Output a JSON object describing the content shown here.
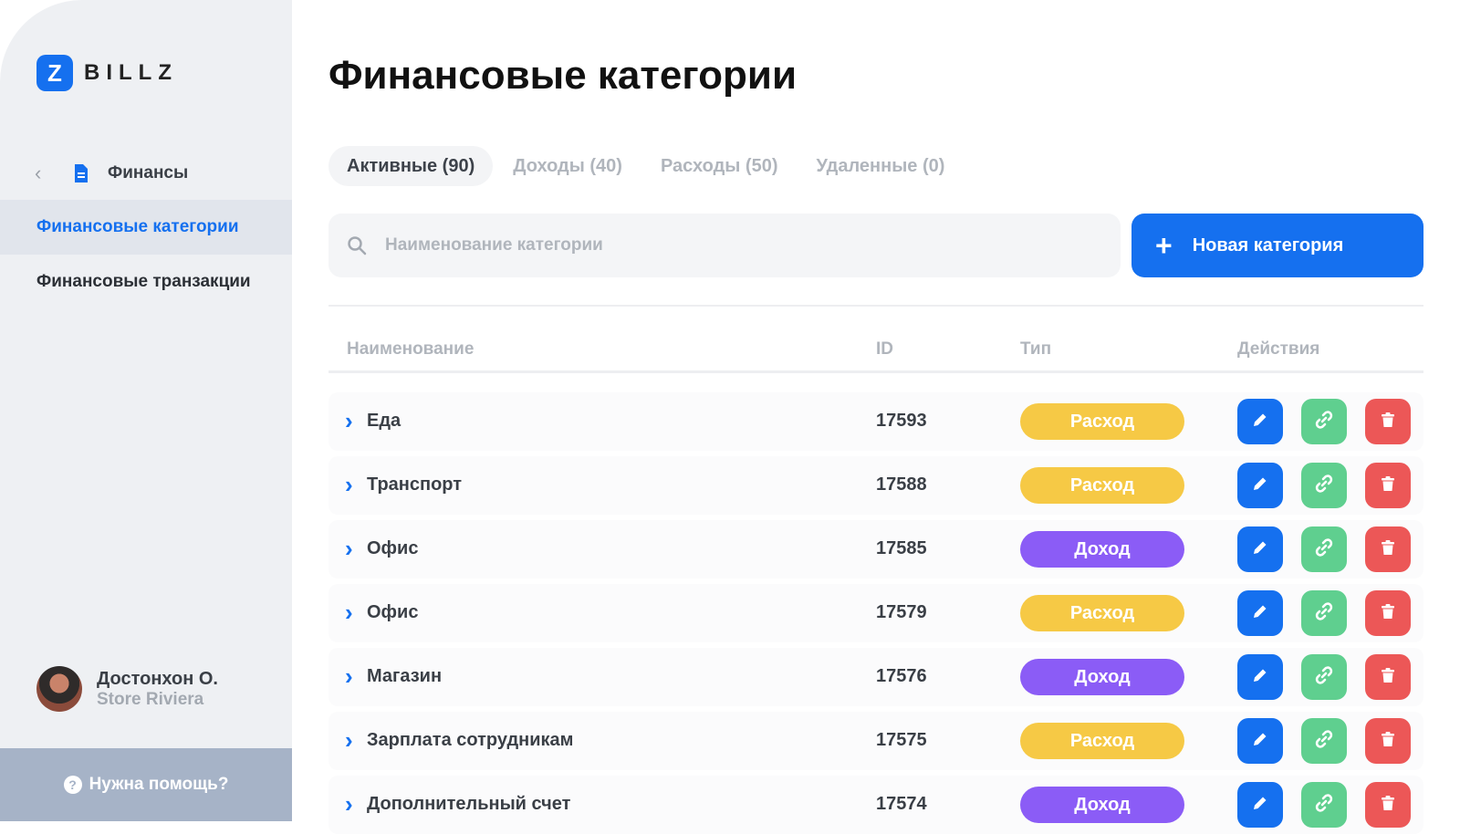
{
  "brand": {
    "badge": "Z",
    "name": "BILLZ"
  },
  "sidebar": {
    "back_label": "Финансы",
    "items": [
      {
        "label": "Финансовые категории",
        "active": true
      },
      {
        "label": "Финансовые транзакции",
        "active": false
      }
    ],
    "user": {
      "name": "Достонхон О.",
      "store": "Store Riviera"
    },
    "help_label": "Нужна помощь?"
  },
  "page": {
    "title": "Финансовые категории",
    "tabs": [
      {
        "label": "Активные (90)",
        "active": true
      },
      {
        "label": "Доходы (40)",
        "active": false
      },
      {
        "label": "Расходы (50)",
        "active": false
      },
      {
        "label": "Удаленные (0)",
        "active": false
      }
    ],
    "search": {
      "placeholder": "Наименование категории",
      "value": ""
    },
    "new_button": "Новая категория"
  },
  "table": {
    "headers": {
      "name": "Наименование",
      "id": "ID",
      "type": "Тип",
      "actions": "Действия"
    },
    "rows": [
      {
        "name": "Еда",
        "id": "17593",
        "type": "Расход"
      },
      {
        "name": "Транспорт",
        "id": "17588",
        "type": "Расход"
      },
      {
        "name": "Офис",
        "id": "17585",
        "type": "Доход"
      },
      {
        "name": "Офис",
        "id": "17579",
        "type": "Расход"
      },
      {
        "name": "Магазин",
        "id": "17576",
        "type": "Доход"
      },
      {
        "name": "Зарплата сотрудникам",
        "id": "17575",
        "type": "Расход"
      },
      {
        "name": "Дополнительный счет",
        "id": "17574",
        "type": "Доход"
      }
    ]
  },
  "colors": {
    "accent": "#1570ef",
    "expense": "#f6c945",
    "income": "#8b5cf6",
    "link_action": "#5fcf8f",
    "delete_action": "#ec5757"
  }
}
